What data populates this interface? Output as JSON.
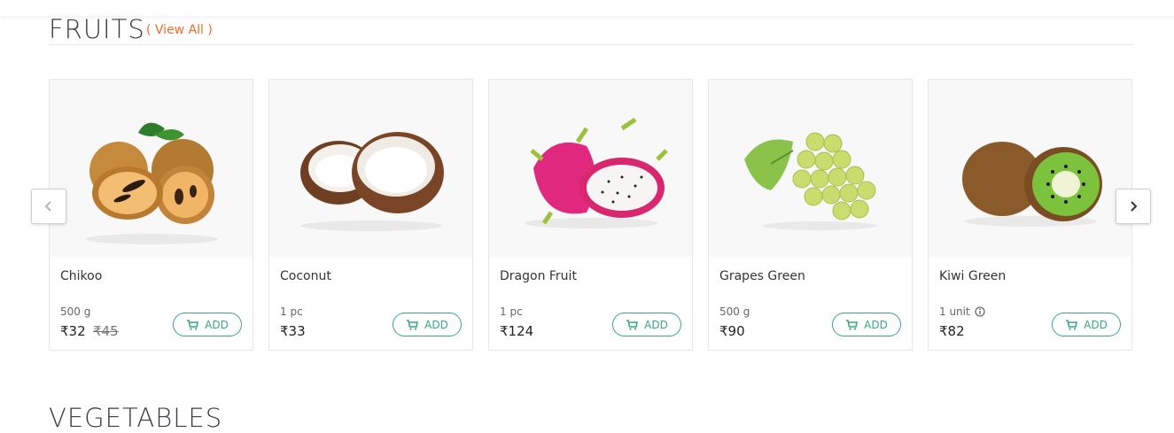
{
  "section": {
    "title": "FRUITS",
    "view_all": "( View All )"
  },
  "carousel": {
    "prev_icon": "chevron-left-icon",
    "next_icon": "chevron-right-icon"
  },
  "products": [
    {
      "name": "Chikoo",
      "qty": "500 g",
      "price": "₹32",
      "mrp": "₹45",
      "add_label": "ADD"
    },
    {
      "name": "Coconut",
      "qty": "1 pc",
      "price": "₹33",
      "add_label": "ADD"
    },
    {
      "name": "Dragon Fruit",
      "qty": "1 pc",
      "price": "₹124",
      "add_label": "ADD"
    },
    {
      "name": "Grapes Green",
      "qty": "500 g",
      "price": "₹90",
      "add_label": "ADD"
    },
    {
      "name": "Kiwi Green",
      "qty": "1 unit",
      "price": "₹82",
      "add_label": "ADD",
      "qty_icon": "info-icon"
    }
  ],
  "next_section": {
    "title": "VEGETABLES"
  },
  "colors": {
    "accent": "#3aa77b",
    "link": "#f26a2a",
    "title": "#3b3b4a"
  }
}
